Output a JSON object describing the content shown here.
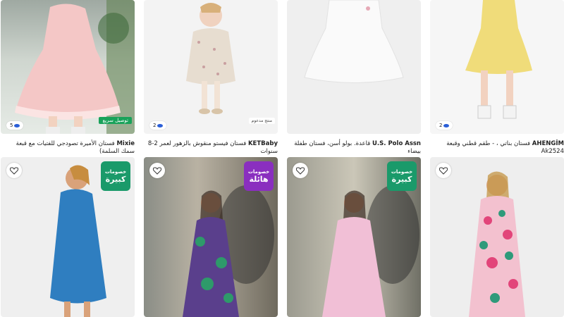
{
  "colors": {
    "green_deal": "#1a9a6a",
    "purple_deal": "#8a2fbf",
    "fast_tag": "#19a25a"
  },
  "row1": [
    {
      "count": "5",
      "tag": "توصيل سريع",
      "brand": "Mixie",
      "title": "فستان الأميرة تصودجي للفتيات مع قبعة سمك السلمة)"
    },
    {
      "count": "2",
      "tag": "منتج مدعوم",
      "brand": "KETBaby",
      "title": "فستان فيستو منقوش بالزهور لعمر 2-8 سنوات"
    },
    {
      "brand": "U.S. Polo Assn",
      "title": "قاعدة. بولو أسن، فستان طفلة بيضاء"
    },
    {
      "count": "2",
      "brand": "AHENGİM",
      "title": "فستان بناتي ، - طقم قطني وقبعة Ak2524"
    }
  ],
  "row2": [
    {
      "deal_line1": "خصومات",
      "deal_line2": "كبيرة"
    },
    {
      "deal_line1": "خصومات",
      "deal_line2": "هائلة"
    },
    {
      "deal_line1": "خصومات",
      "deal_line2": "كبيرة"
    },
    {}
  ]
}
